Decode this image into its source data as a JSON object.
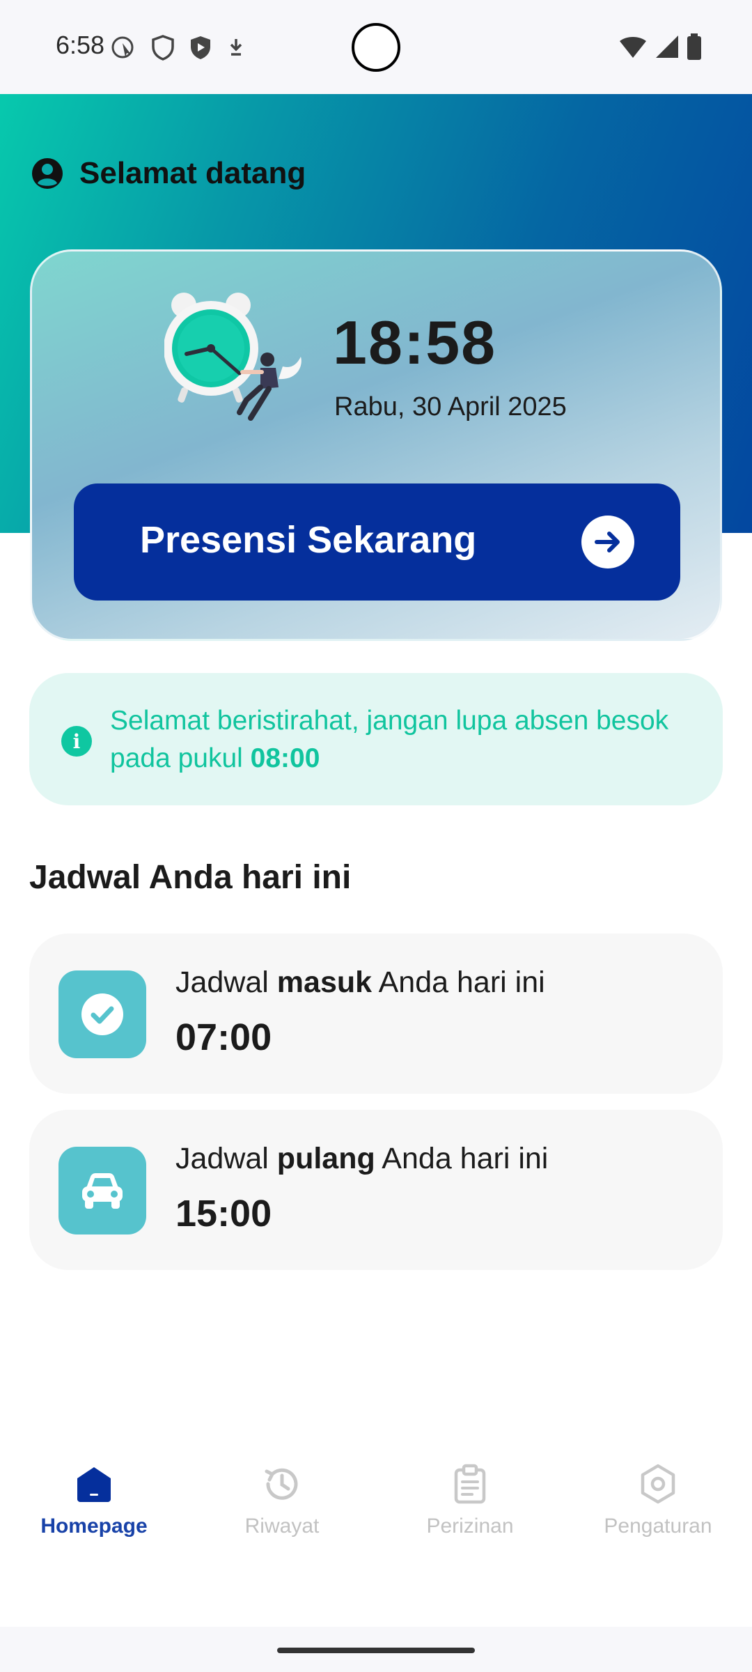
{
  "status_bar": {
    "time": "6:58"
  },
  "header": {
    "welcome": "Selamat datang",
    "gradient_start": "#07c9ad",
    "gradient_end": "#0347a0"
  },
  "clock_card": {
    "time": "18:58",
    "date": "Rabu, 30 April 2025",
    "button_label": "Presensi Sekarang"
  },
  "info": {
    "text": "Selamat beristirahat, jangan lupa absen besok pada pukul ",
    "time": "08:00"
  },
  "schedule": {
    "title": "Jadwal Anda hari ini",
    "items": [
      {
        "prefix": "Jadwal ",
        "emphasis": "masuk",
        "suffix": " Anda hari ini",
        "time": "07:00",
        "icon": "check-circle-icon"
      },
      {
        "prefix": "Jadwal ",
        "emphasis": "pulang",
        "suffix": " Anda hari ini",
        "time": "15:00",
        "icon": "car-icon"
      }
    ]
  },
  "nav": {
    "items": [
      {
        "label": "Homepage",
        "icon": "home-icon",
        "active": true
      },
      {
        "label": "Riwayat",
        "icon": "history-icon",
        "active": false
      },
      {
        "label": "Perizinan",
        "icon": "clipboard-icon",
        "active": false
      },
      {
        "label": "Pengaturan",
        "icon": "settings-icon",
        "active": false
      }
    ]
  },
  "colors": {
    "primary": "#052f9c",
    "accent": "#10c49e",
    "schedule_icon_bg": "#56c3cd"
  }
}
